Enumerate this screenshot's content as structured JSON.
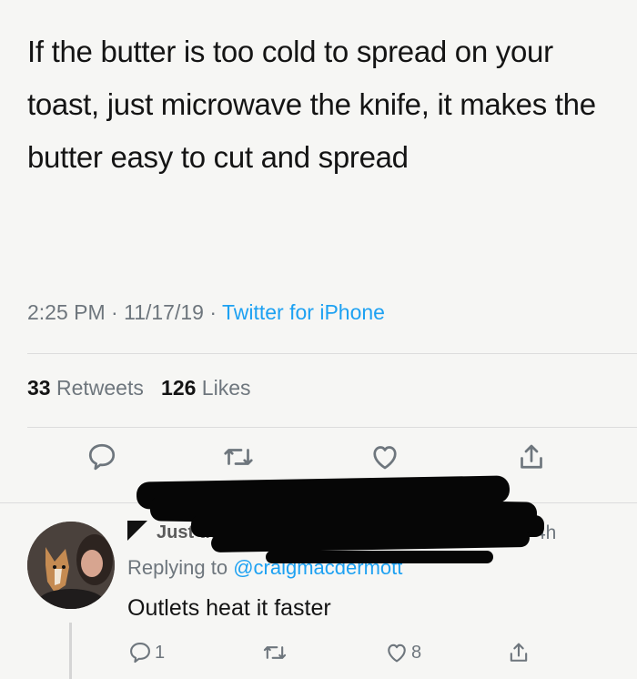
{
  "tweet": {
    "text": "If the butter is too cold to spread on your toast, just microwave the knife, it makes the butter easy to cut and spread",
    "time": "2:25 PM",
    "date": "11/17/19",
    "separator": "·",
    "source": "Twitter for iPhone",
    "retweet_count": "33",
    "retweet_label": "Retweets",
    "like_count": "126",
    "like_label": "Likes"
  },
  "icons": {
    "reply": "reply-icon",
    "retweet": "retweet-icon",
    "like": "heart-icon",
    "share": "share-icon",
    "more": "chevron-down-icon"
  },
  "reply": {
    "name": "Just the Tip",
    "time": "4h",
    "replying_prefix": "Replying to",
    "handle": "@craigmacdermott",
    "text": "Outlets heat it faster",
    "reply_count": "1",
    "like_count": "8"
  },
  "colors": {
    "accent": "#1da1f2",
    "muted": "#6e767d",
    "background": "#f6f6f4"
  }
}
